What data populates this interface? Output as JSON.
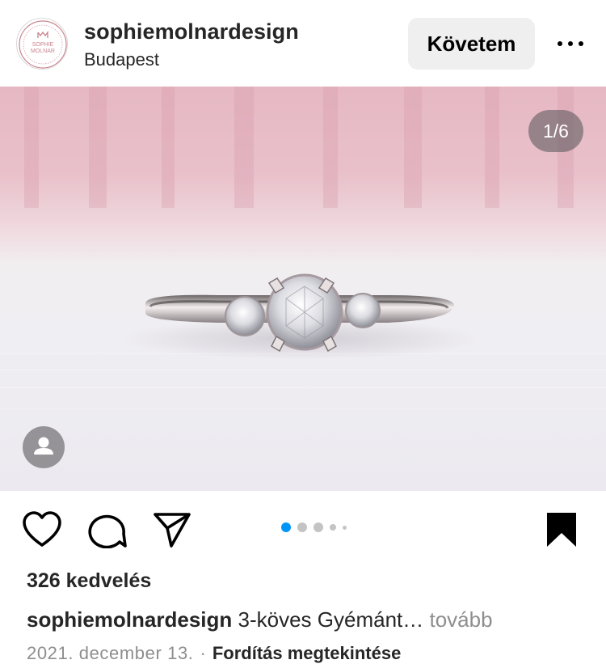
{
  "post": {
    "username": "sophiemolnardesign",
    "location": "Budapest",
    "follow_label": "Követem",
    "more_icon": "more-horizontal-icon",
    "avatar_logo": {
      "line1": "SOPHIE",
      "line2": "MOLNAR"
    }
  },
  "media": {
    "counter": "1/6",
    "user_tag_icon": "person-icon",
    "carousel_dot_count": 5,
    "active_dot_index": 0,
    "accent_color": "#0095f6"
  },
  "actions": {
    "like_icon": "heart-icon",
    "comment_icon": "comment-icon",
    "share_icon": "send-icon",
    "save_icon": "bookmark-icon"
  },
  "meta": {
    "likes": "326 kedvelés",
    "caption_user": "sophiemolnardesign",
    "caption_text": "3-köves Gyémánt…",
    "caption_more": "tovább",
    "date": "2021. december 13.",
    "separator": "·",
    "translate_label": "Fordítás megtekintése"
  }
}
